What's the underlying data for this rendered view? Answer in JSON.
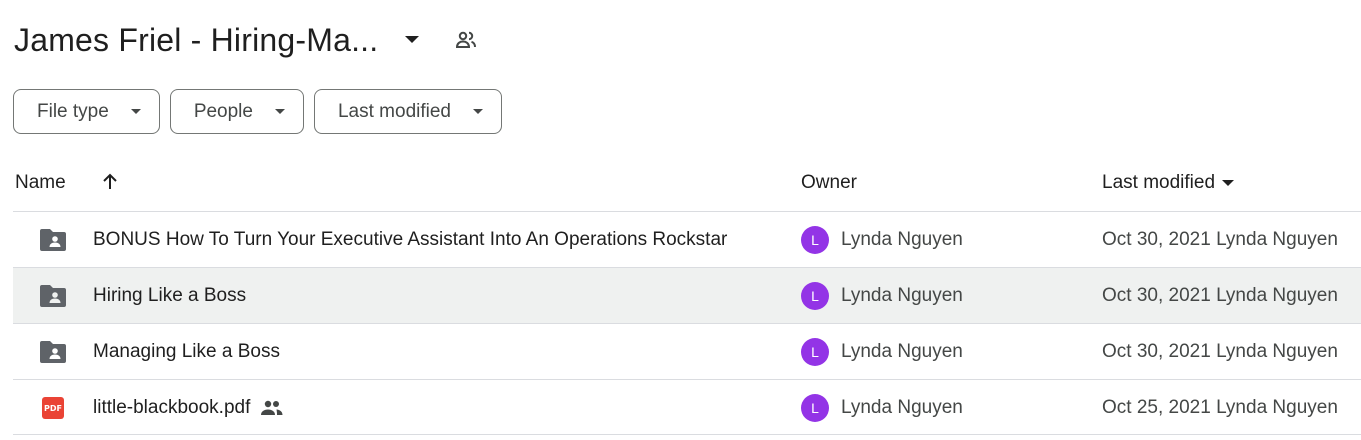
{
  "header": {
    "title": "James Friel - Hiring-Ma...",
    "caret_icon": "arrow-drop-down-icon",
    "shared_icon": "people-icon"
  },
  "filters": [
    {
      "label": "File type"
    },
    {
      "label": "People"
    },
    {
      "label": "Last modified"
    }
  ],
  "columns": {
    "name": "Name",
    "owner": "Owner",
    "last_modified": "Last modified"
  },
  "rows": [
    {
      "type": "shared-folder",
      "name": "BONUS How To Turn Your Executive Assistant Into An Operations Rockstar",
      "owner_initial": "L",
      "owner": "Lynda Nguyen",
      "modified": "Oct 30, 2021 Lynda Nguyen",
      "shared": false,
      "selected": false
    },
    {
      "type": "shared-folder",
      "name": "Hiring Like a Boss",
      "owner_initial": "L",
      "owner": "Lynda Nguyen",
      "modified": "Oct 30, 2021 Lynda Nguyen",
      "shared": false,
      "selected": true
    },
    {
      "type": "shared-folder",
      "name": "Managing Like a Boss",
      "owner_initial": "L",
      "owner": "Lynda Nguyen",
      "modified": "Oct 30, 2021 Lynda Nguyen",
      "shared": false,
      "selected": false
    },
    {
      "type": "pdf",
      "name": "little-blackbook.pdf",
      "file_badge": "PDF",
      "owner_initial": "L",
      "owner": "Lynda Nguyen",
      "modified": "Oct 25, 2021 Lynda Nguyen",
      "shared": true,
      "selected": false
    }
  ],
  "colors": {
    "avatar": "#9334e6",
    "selected_row": "#eff1f0",
    "pdf": "#ea4335",
    "folder": "#5f6368"
  }
}
